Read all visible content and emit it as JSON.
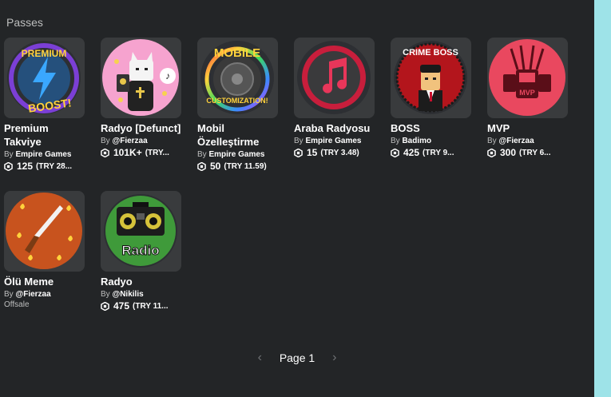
{
  "section": {
    "title": "Passes"
  },
  "by_label": "By",
  "passes": [
    {
      "name": "Premium Takviye",
      "creator": "Empire Games",
      "robux": "125",
      "currency": "(TRY 28...",
      "icon": "lightning-icon",
      "art_text_top": "PREMIUM",
      "art_text_bottom": "BOOST!"
    },
    {
      "name": "Radyo [Defunct]",
      "creator": "@Fierzaa",
      "robux": "101K+",
      "currency": "(TRY...",
      "icon": "cat-radio-icon"
    },
    {
      "name": "Mobil Özelleştirme",
      "creator": "Empire Games",
      "robux": "50",
      "currency": "(TRY 11.59)",
      "icon": "tire-icon",
      "art_text_top": "MOBILE",
      "art_text_bottom": "CUSTOMIZATION!"
    },
    {
      "name": "Araba Radyosu",
      "creator": "Empire Games",
      "robux": "15",
      "currency": "(TRY 3.48)",
      "icon": "music-note-icon"
    },
    {
      "name": "BOSS",
      "creator": "Badimo",
      "robux": "425",
      "currency": "(TRY 9...",
      "icon": "crime-boss-icon",
      "art_text_top": "CRIME BOSS"
    },
    {
      "name": "MVP",
      "creator": "@Fierzaa",
      "robux": "300",
      "currency": "(TRY 6...",
      "icon": "mvp-badge-icon",
      "art_text_top": "MVP"
    },
    {
      "name": "Ölü Meme",
      "creator": "@Fierzaa",
      "offsale": "Offsale",
      "icon": "knife-icon"
    },
    {
      "name": "Radyo",
      "creator": "@Nikilis",
      "robux": "475",
      "currency": "(TRY 11...",
      "icon": "radio-icon",
      "art_text_top": "Radio"
    }
  ],
  "pagination": {
    "label": "Page 1"
  },
  "colors": {
    "background": "#232527",
    "card": "#393b3d",
    "accent_strip": "#9ee3e8"
  }
}
